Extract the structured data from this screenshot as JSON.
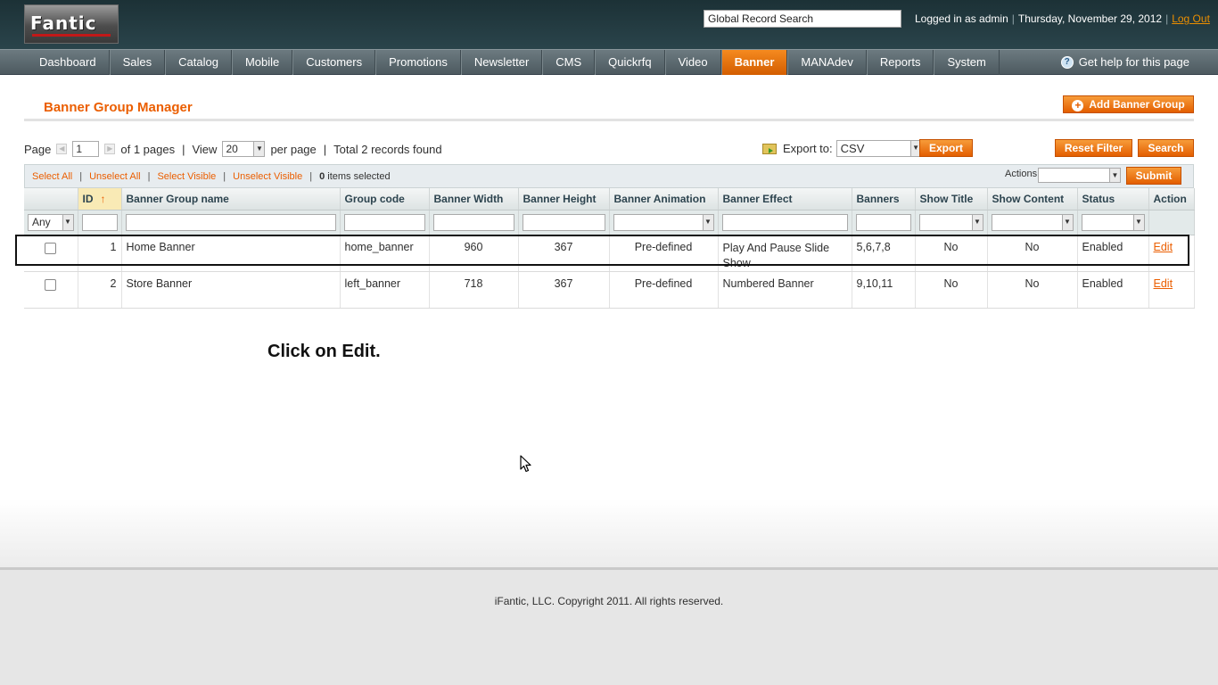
{
  "header": {
    "logo_text": "Fantic",
    "search_placeholder": "Global Record Search",
    "logged_in": "Logged in as admin",
    "date": "Thursday, November 29, 2012",
    "logout": "Log Out"
  },
  "nav": {
    "items": [
      "Dashboard",
      "Sales",
      "Catalog",
      "Mobile",
      "Customers",
      "Promotions",
      "Newsletter",
      "CMS",
      "Quickrfq",
      "Video",
      "Banner",
      "MANAdev",
      "Reports",
      "System"
    ],
    "active": "Banner",
    "help": "Get help for this page"
  },
  "page": {
    "title": "Banner Group Manager",
    "add_button": "Add Banner Group"
  },
  "pager": {
    "page_label": "Page",
    "page_value": "1",
    "of_pages": "of 1 pages",
    "view_label": "View",
    "view_value": "20",
    "per_page": "per page",
    "total": "Total 2 records found"
  },
  "export": {
    "label": "Export to:",
    "format": "CSV",
    "button": "Export"
  },
  "buttons": {
    "reset_filter": "Reset Filter",
    "search": "Search",
    "submit": "Submit"
  },
  "massaction": {
    "select_all": "Select All",
    "unselect_all": "Unselect All",
    "select_visible": "Select Visible",
    "unselect_visible": "Unselect Visible",
    "selected_count": "0",
    "selected_text": "items selected",
    "actions_label": "Actions"
  },
  "grid": {
    "columns": [
      "ID",
      "Banner Group name",
      "Group code",
      "Banner Width",
      "Banner Height",
      "Banner Animation",
      "Banner Effect",
      "Banners",
      "Show Title",
      "Show Content",
      "Status",
      "Action"
    ],
    "sort_indicator": "↑",
    "filter_any": "Any",
    "rows": [
      {
        "id": "1",
        "name": "Home Banner",
        "code": "home_banner",
        "width": "960",
        "height": "367",
        "animation": "Pre-defined",
        "effect": "Play And Pause Slide Show",
        "banners": "5,6,7,8",
        "show_title": "No",
        "show_content": "No",
        "status": "Enabled",
        "action": "Edit"
      },
      {
        "id": "2",
        "name": "Store Banner",
        "code": "left_banner",
        "width": "718",
        "height": "367",
        "animation": "Pre-defined",
        "effect": "Numbered Banner",
        "banners": "9,10,11",
        "show_title": "No",
        "show_content": "No",
        "status": "Enabled",
        "action": "Edit"
      }
    ]
  },
  "instruction": "Click on Edit.",
  "footer": {
    "copyright": "iFantic, LLC. Copyright 2011. All rights reserved."
  }
}
